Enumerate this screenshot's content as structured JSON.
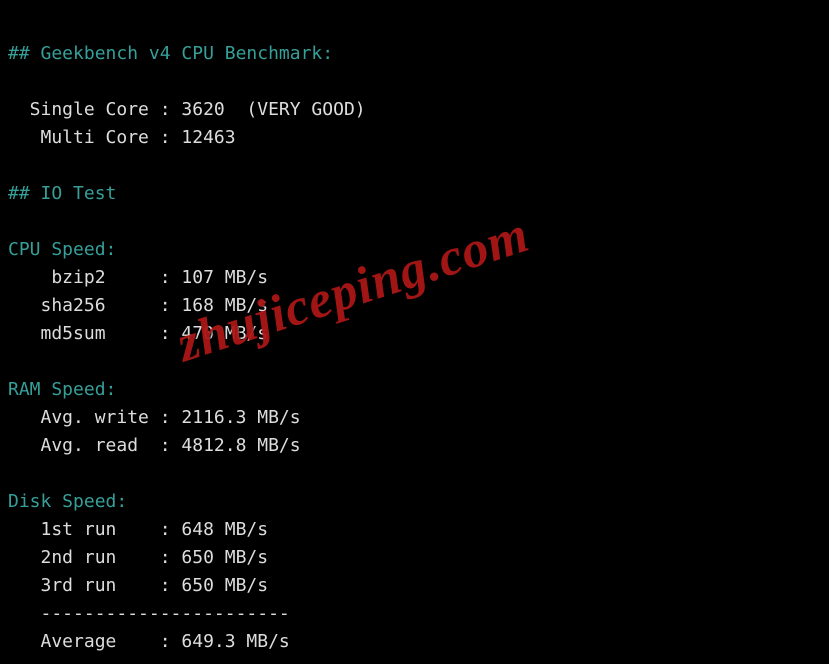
{
  "section1": {
    "heading": "## Geekbench v4 CPU Benchmark:",
    "single": {
      "label": "  Single Core : ",
      "value": "3620  (VERY GOOD)"
    },
    "multi": {
      "label": "   Multi Core : ",
      "value": "12463"
    }
  },
  "section2": {
    "heading": "## IO Test"
  },
  "cpuSpeed": {
    "heading": "CPU Speed:",
    "rows": [
      {
        "label": "    bzip2     : ",
        "value": "107 MB/s"
      },
      {
        "label": "   sha256     : ",
        "value": "168 MB/s"
      },
      {
        "label": "   md5sum     : ",
        "value": "470 MB/s"
      }
    ]
  },
  "ramSpeed": {
    "heading": "RAM Speed:",
    "rows": [
      {
        "label": "   Avg. write : ",
        "value": "2116.3 MB/s"
      },
      {
        "label": "   Avg. read  : ",
        "value": "4812.8 MB/s"
      }
    ]
  },
  "diskSpeed": {
    "heading": "Disk Speed:",
    "rows": [
      {
        "label": "   1st run    : ",
        "value": "648 MB/s"
      },
      {
        "label": "   2nd run    : ",
        "value": "650 MB/s"
      },
      {
        "label": "   3rd run    : ",
        "value": "650 MB/s"
      }
    ],
    "divider": "   -----------------------",
    "avg": {
      "label": "   Average    : ",
      "value": "649.3 MB/s"
    }
  },
  "watermark": "zhujiceping.com"
}
